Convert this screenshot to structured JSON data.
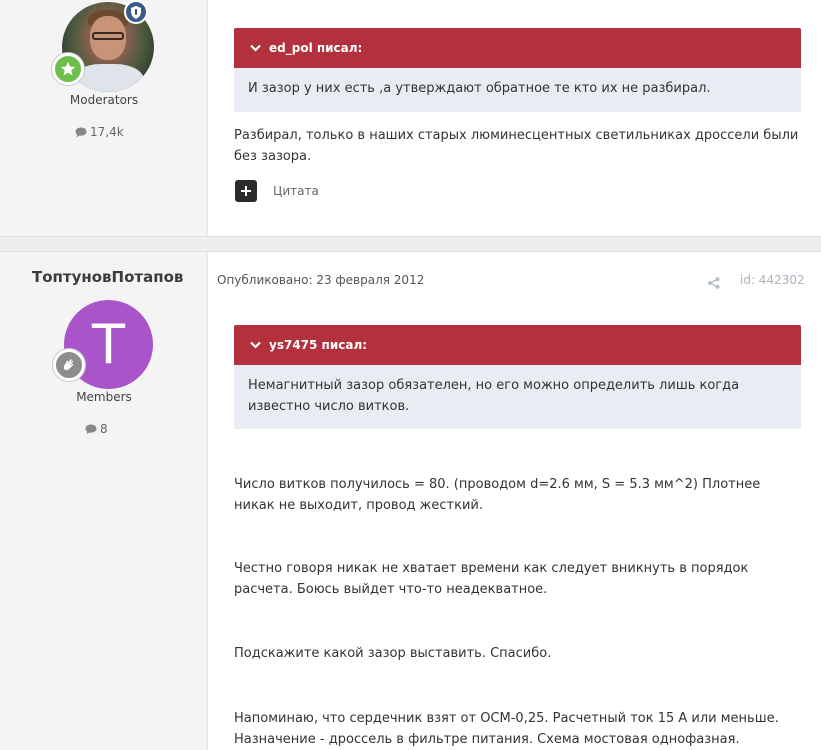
{
  "post1": {
    "group": "Moderators",
    "post_count": "17,4k",
    "quote": {
      "author_line": "ed_pol писал:",
      "text": "И зазор у них есть ,а утверждают обратное те кто их не разбирал."
    },
    "body": "Разбирал, только в наших старых люминесцентных светильниках дроссели были без зазора.",
    "actions": {
      "quote_label": "Цитата"
    }
  },
  "post2": {
    "author": "ТоптуновПотапов",
    "avatar_letter": "T",
    "avatar_color": "#a954c9",
    "group": "Members",
    "post_count": "8",
    "published": "Опубликовано: 23 февраля 2012",
    "post_id": "id: 442302",
    "quote": {
      "author_line": "ys7475 писал:",
      "text": "Немагнитный зазор обязателен, но его можно определить лишь когда известно число витков."
    },
    "paragraphs": [
      "Число витков получилось = 80. (проводом d=2.6 мм, S = 5.3 мм^2) Плотнее никак не выходит, провод жесткий.",
      "Честно говоря никак не хватает времени как следует вникнуть в порядок расчета. Боюсь выйдет что-то неадекватное.",
      "Подскажите какой зазор выставить. Спасибо.",
      "Напоминаю, что сердечник взят от ОСМ-0,25. Расчетный ток 15 А или меньше. Назначение - дроссель в фильтре питания. Схема мостовая однофазная."
    ]
  },
  "colors": {
    "quote_header": "#b3313c",
    "quote_body": "#e8edf3",
    "sidebar": "#f4f4f5",
    "moderator_badge": "#6cbf4a",
    "shield_badge": "#3a5b8c"
  },
  "icons": {
    "post_count": "comment-icon",
    "quote_toggle": "chevron-down-icon",
    "multiquote": "plus-icon",
    "share": "share-icon"
  }
}
